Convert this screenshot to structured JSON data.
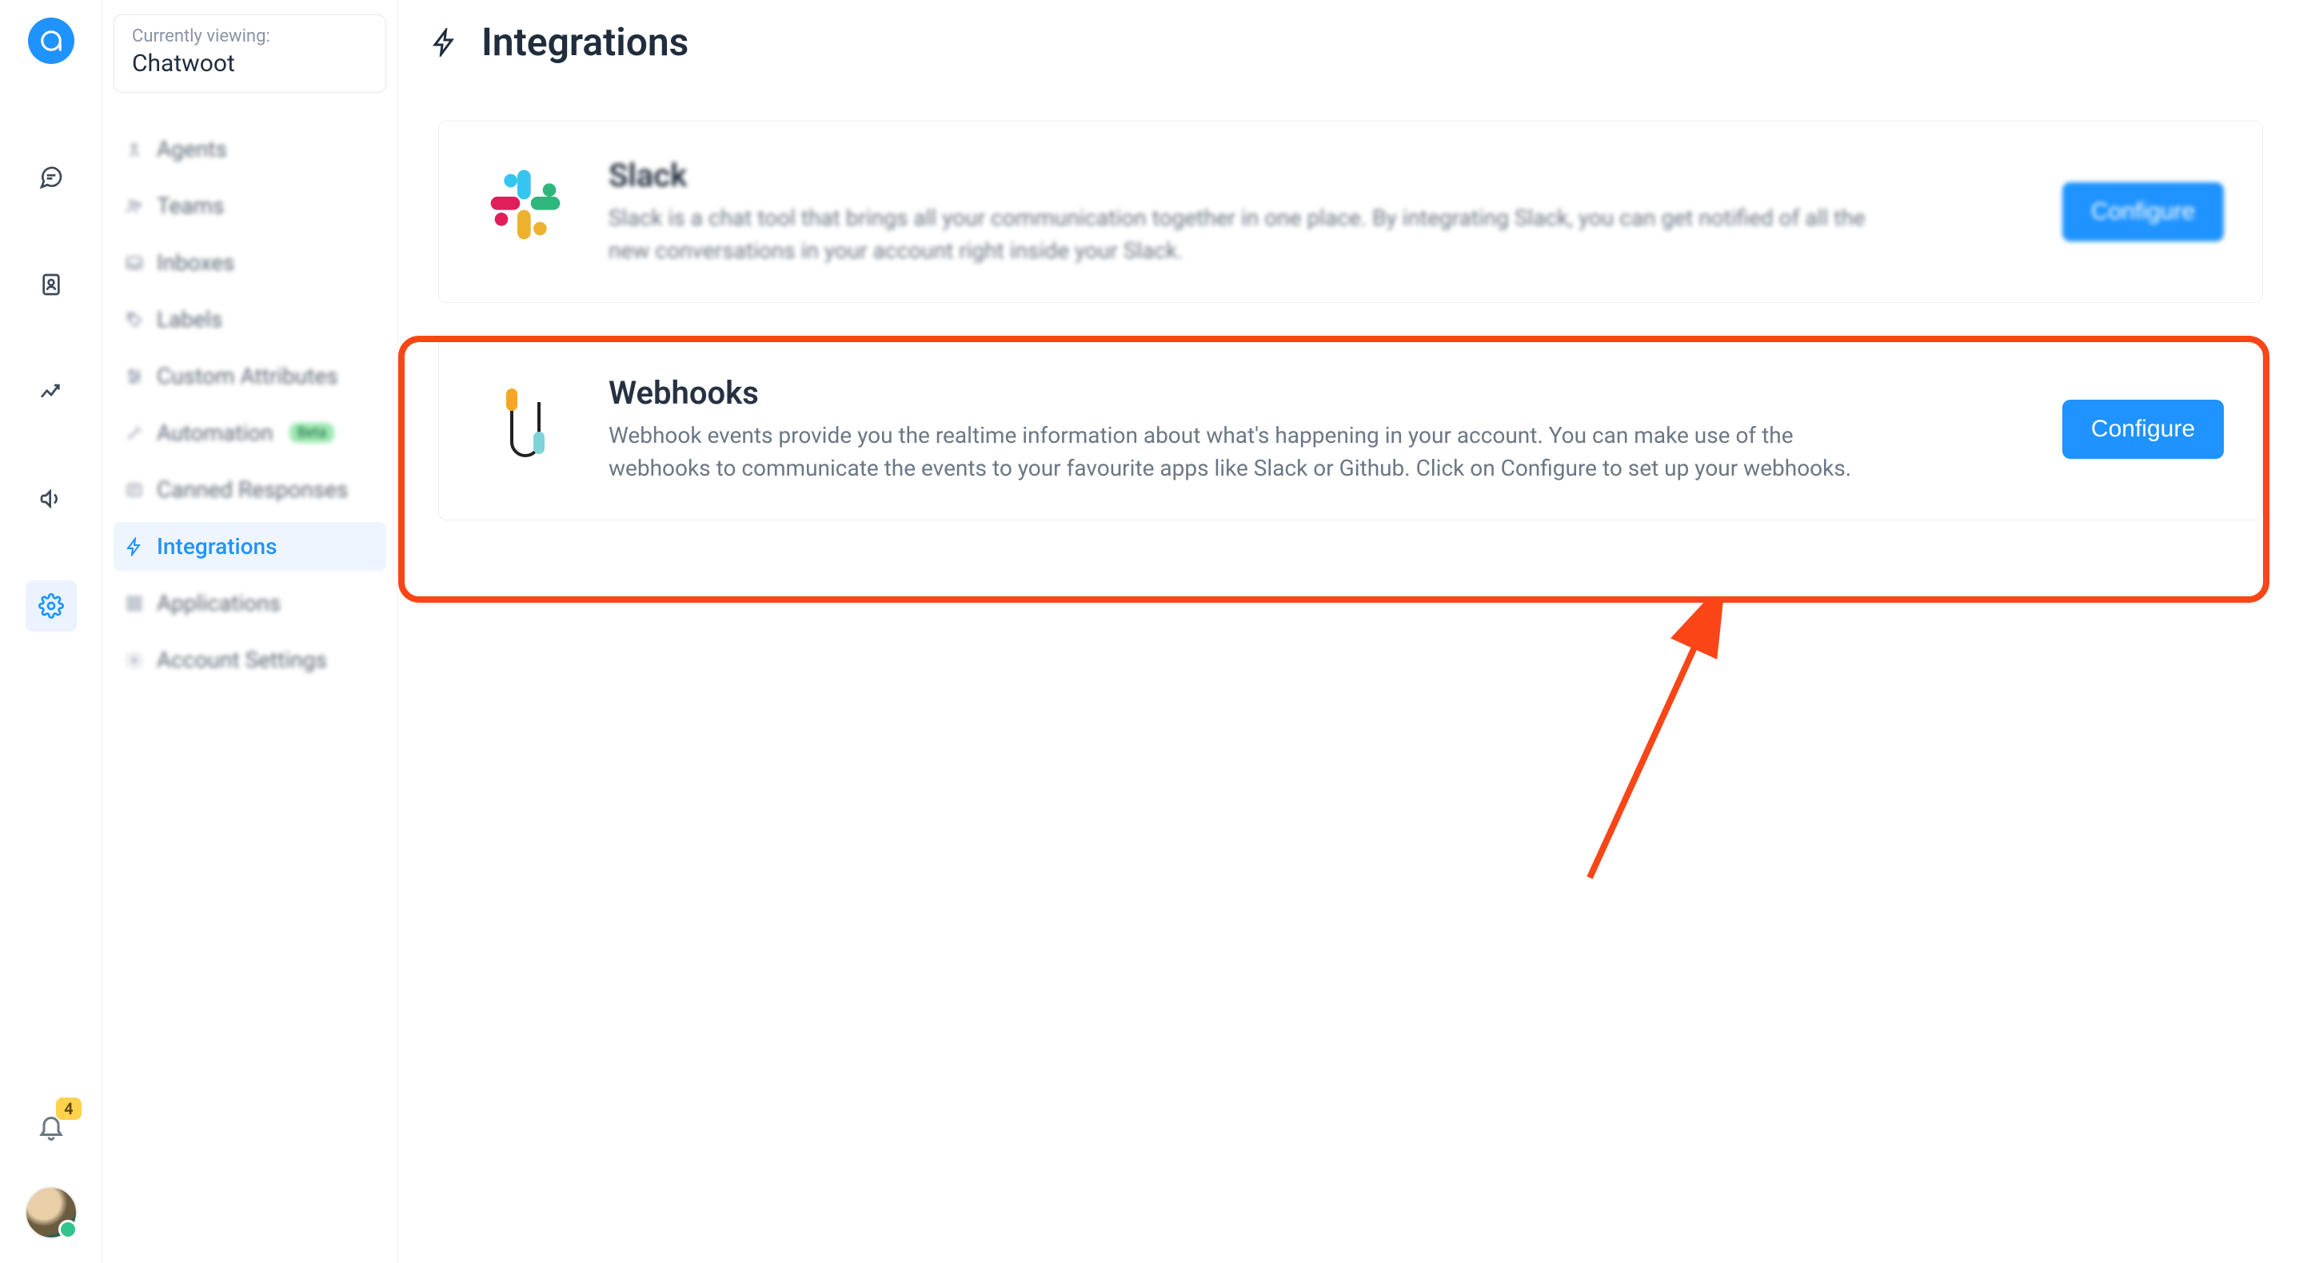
{
  "brand": "Chatwoot",
  "rail": {
    "items": [
      "chat",
      "contacts",
      "reports",
      "campaigns",
      "settings"
    ],
    "active_index": 4,
    "notification_count": "4"
  },
  "sidebar": {
    "currently_viewing_label": "Currently viewing:",
    "currently_viewing_value": "Chatwoot",
    "items": [
      {
        "key": "agents",
        "label": "Agents",
        "icon": "users"
      },
      {
        "key": "teams",
        "label": "Teams",
        "icon": "team"
      },
      {
        "key": "inboxes",
        "label": "Inboxes",
        "icon": "inbox"
      },
      {
        "key": "labels",
        "label": "Labels",
        "icon": "tag"
      },
      {
        "key": "custom-attributes",
        "label": "Custom Attributes",
        "icon": "sliders"
      },
      {
        "key": "automation",
        "label": "Automation",
        "icon": "wand",
        "badge": "Beta"
      },
      {
        "key": "canned-responses",
        "label": "Canned Responses",
        "icon": "canned"
      },
      {
        "key": "integrations",
        "label": "Integrations",
        "icon": "bolt",
        "active": true
      },
      {
        "key": "applications",
        "label": "Applications",
        "icon": "grid"
      },
      {
        "key": "account-settings",
        "label": "Account Settings",
        "icon": "gear"
      }
    ]
  },
  "page": {
    "title": "Integrations"
  },
  "integrations": [
    {
      "key": "slack",
      "title": "Slack",
      "description": "Slack is a chat tool that brings all your communication together in one place. By integrating Slack, you can get notified of all the new conversations in your account right inside your Slack.",
      "action_label": "Configure",
      "blurred": true
    },
    {
      "key": "webhooks",
      "title": "Webhooks",
      "description": "Webhook events provide you the realtime information about what's happening in your account. You can make use of the webhooks to communicate the events to your favourite apps like Slack or Github. Click on Configure to set up your webhooks.",
      "action_label": "Configure",
      "highlighted": true
    }
  ],
  "colors": {
    "accent": "#1f93ff",
    "highlight": "#fa4616"
  }
}
